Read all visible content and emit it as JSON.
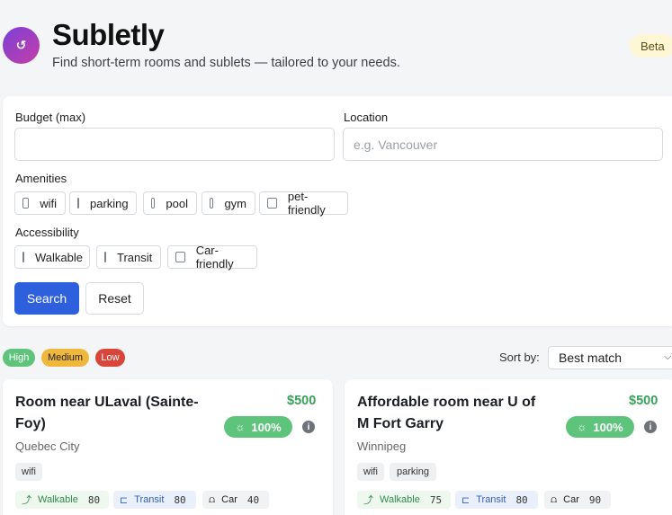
{
  "app": {
    "logo_glyph": "↺",
    "title": "Subletly",
    "subtitle": "Find short-term rooms and sublets — tailored to your needs.",
    "badge": "Beta"
  },
  "filters": {
    "budget_label": "Budget (max)",
    "budget_value": "",
    "location_label": "Location",
    "location_placeholder": "e.g. Vancouver",
    "amenities_label": "Amenities",
    "amenities": [
      "wifi",
      "parking",
      "pool",
      "gym",
      "pet-friendly"
    ],
    "accessibility_label": "Accessibility",
    "accessibility": [
      "Walkable",
      "Transit",
      "Car-friendly"
    ],
    "search_label": "Search",
    "reset_label": "Reset"
  },
  "legend": {
    "items": [
      {
        "label": "High",
        "color": "#5ec47b"
      },
      {
        "label": "Medium",
        "color": "#f0b73d"
      },
      {
        "label": "Low",
        "color": "#d9453b"
      }
    ]
  },
  "sort": {
    "label": "Sort by:",
    "selected": "Best match"
  },
  "listings": [
    {
      "title": "Room near ULaval (Sainte-Foy)",
      "price": "$500",
      "score": "100%",
      "city": "Quebec City",
      "amenities": [
        "wifi"
      ],
      "access": {
        "walk_label": "Walkable",
        "walk": "80",
        "transit_label": "Transit",
        "transit": "80",
        "car_label": "Car",
        "car": "40"
      }
    },
    {
      "title": "Affordable room near U of M Fort Garry",
      "price": "$500",
      "score": "100%",
      "city": "Winnipeg",
      "amenities": [
        "wifi",
        "parking"
      ],
      "access": {
        "walk_label": "Walkable",
        "walk": "75",
        "transit_label": "Transit",
        "transit": "80",
        "car_label": "Car",
        "car": "90"
      }
    }
  ],
  "icons": {
    "info": "i",
    "sun": "☼",
    "walk": "⤴",
    "transit": "⊏",
    "car": "⩍",
    "chevron": "⌵"
  }
}
